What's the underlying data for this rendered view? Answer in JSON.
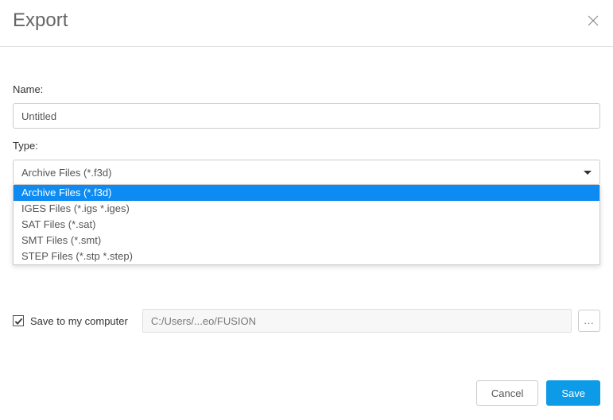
{
  "dialog": {
    "title": "Export"
  },
  "fields": {
    "name_label": "Name:",
    "name_value": "Untitled",
    "type_label": "Type:",
    "type_selected": "Archive Files (*.f3d)",
    "type_options": [
      "Archive Files (*.f3d)",
      "IGES Files (*.igs *.iges)",
      "SAT Files (*.sat)",
      "SMT Files (*.smt)",
      "STEP Files (*.stp *.step)"
    ]
  },
  "save_local": {
    "checked": true,
    "label": "Save to my computer",
    "path": "C:/Users/...eo/FUSION",
    "browse": "..."
  },
  "buttons": {
    "cancel": "Cancel",
    "save": "Save"
  }
}
